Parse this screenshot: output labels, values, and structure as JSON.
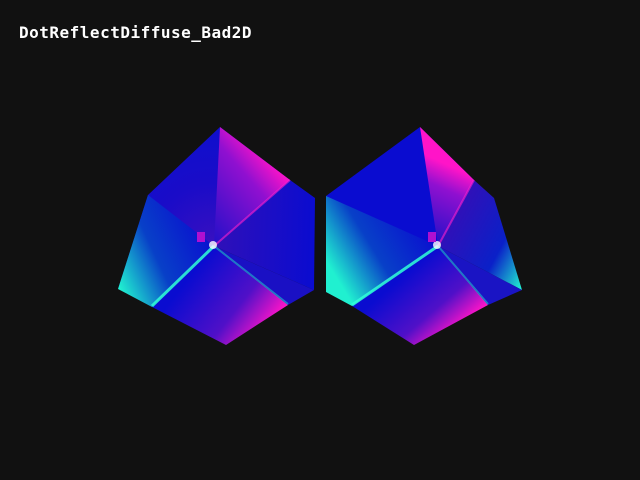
{
  "window": {
    "title": "DotReflectDiffuse_Bad2D"
  },
  "scene": {
    "background_color": "#111111",
    "shapes": [
      {
        "name": "left-shaded-cube",
        "base_color": "#0a0ad0",
        "highlight_color": "#ff10c8",
        "rim_color": "#20ffd0"
      },
      {
        "name": "right-shaded-cube",
        "base_color": "#0a0ad0",
        "highlight_color": "#ff10c8",
        "rim_color": "#20ffd0"
      }
    ]
  }
}
